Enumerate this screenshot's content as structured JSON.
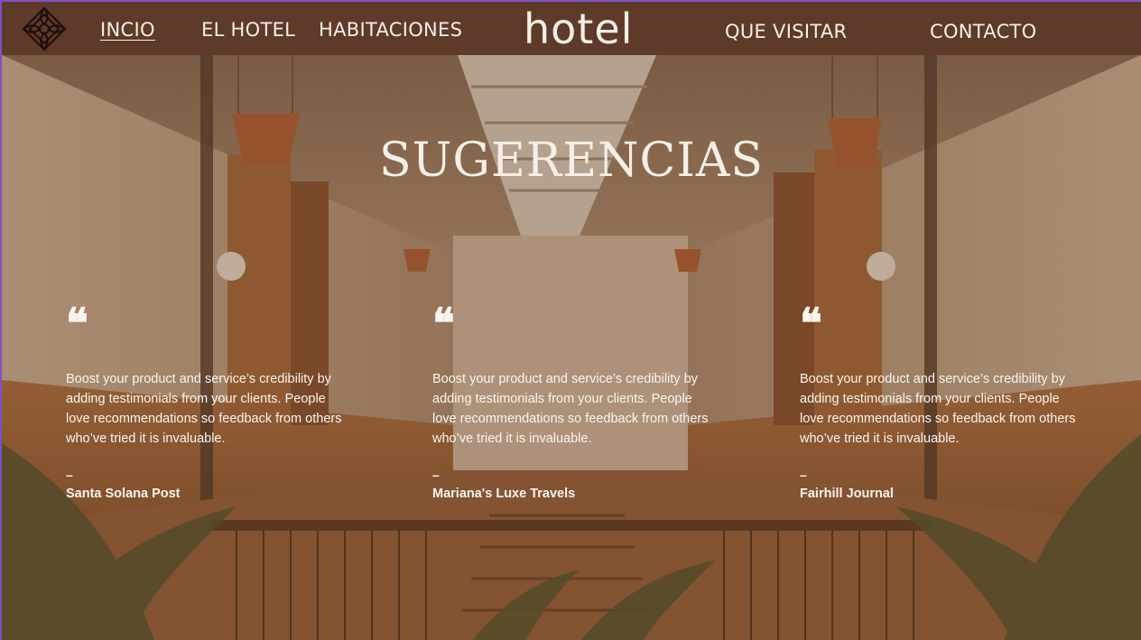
{
  "nav": {
    "items": [
      {
        "label": "INCIO",
        "active": true
      },
      {
        "label": "EL HOTEL",
        "active": false
      },
      {
        "label": "HABITACIONES",
        "active": false
      },
      {
        "label": "QUE VISITAR",
        "active": false
      },
      {
        "label": "CONTACTO",
        "active": false
      }
    ],
    "brand": "hotel"
  },
  "section": {
    "title": "SUGERENCIAS"
  },
  "testimonials": [
    {
      "quote_mark": "❝",
      "text": "Boost your product and service’s credibility by adding testimonials from your clients. People love recommendations so feedback from others who’ve tried it is invaluable.",
      "dash": "–",
      "source": "Santa Solana Post"
    },
    {
      "quote_mark": "❝",
      "text": "Boost your product and service’s credibility by adding testimonials from your clients. People love recommendations so feedback from others who’ve tried it is invaluable.",
      "dash": "–",
      "source": "Mariana's Luxe Travels"
    },
    {
      "quote_mark": "❝",
      "text": "Boost your product and service’s credibility by adding testimonials from your clients. People love recommendations so feedback from others who’ve tried it is invaluable.",
      "dash": "–",
      "source": "Fairhill Journal"
    }
  ],
  "colors": {
    "navbar_bg": "#5e3a29",
    "text_light": "#f7efe6",
    "overlay": "#784e30"
  },
  "icons": {
    "logo": "ornamental-diamond-logo-icon"
  }
}
